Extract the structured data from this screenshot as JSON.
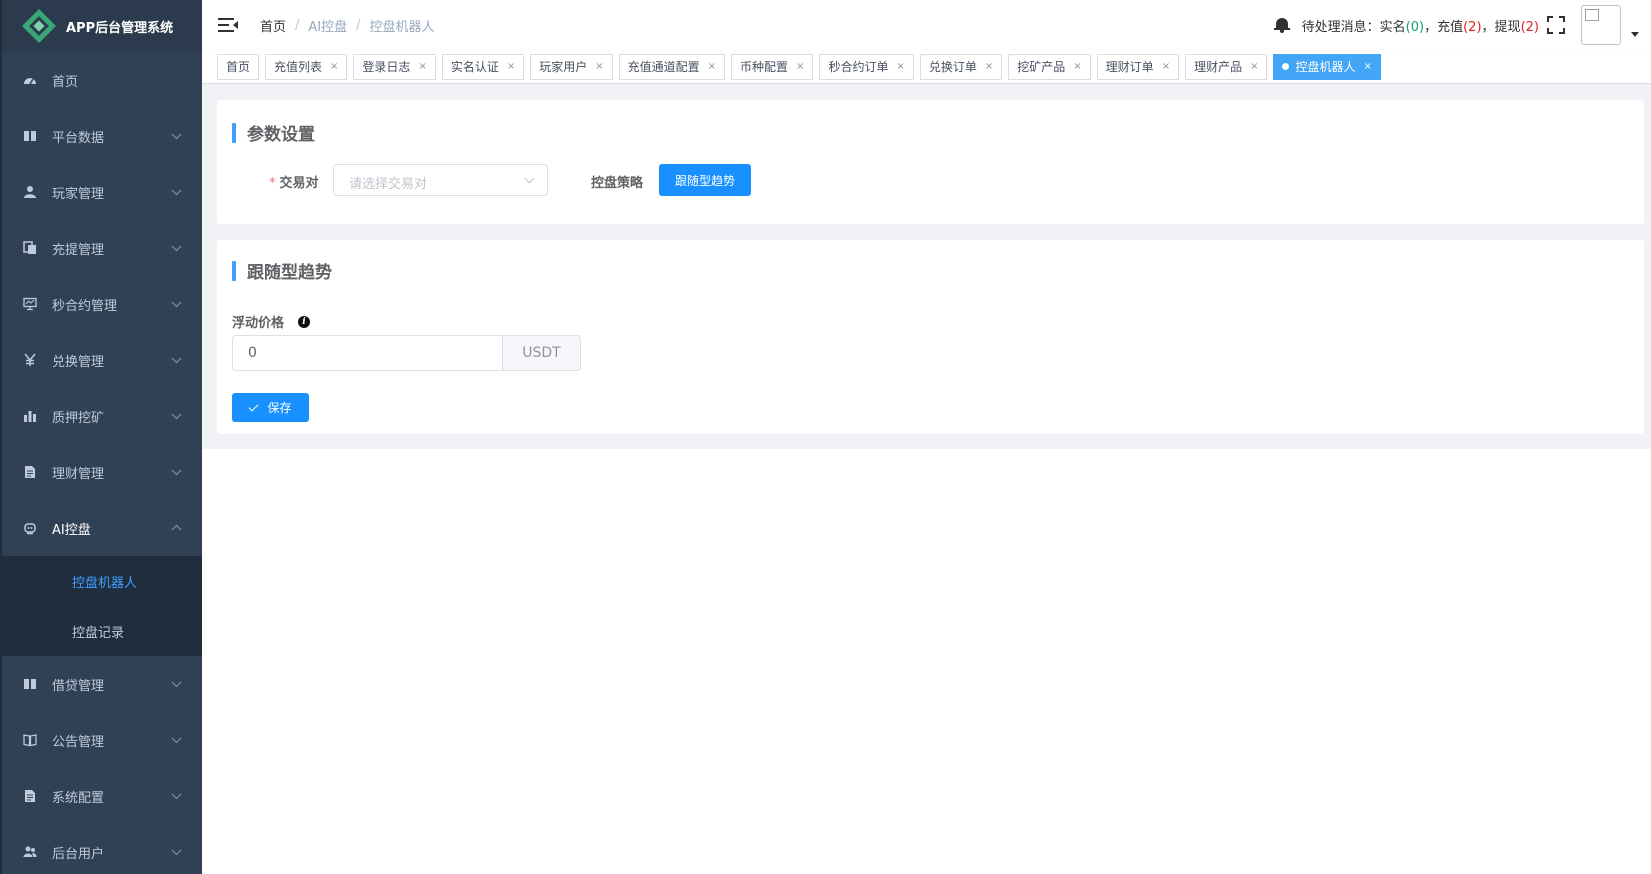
{
  "app": {
    "title": "APP后台管理系统"
  },
  "sidebar": {
    "items": [
      {
        "label": "首页",
        "icon": "dashboard-icon"
      },
      {
        "label": "平台数据",
        "icon": "book-icon"
      },
      {
        "label": "玩家管理",
        "icon": "user-icon"
      },
      {
        "label": "充提管理",
        "icon": "copy-icon"
      },
      {
        "label": "秒合约管理",
        "icon": "monitor-icon"
      },
      {
        "label": "兑换管理",
        "icon": "yen-icon"
      },
      {
        "label": "质押挖矿",
        "icon": "bar-chart-icon"
      },
      {
        "label": "理财管理",
        "icon": "file-text-icon"
      },
      {
        "label": "AI控盘",
        "icon": "robot-icon"
      },
      {
        "label": "借贷管理",
        "icon": "book-icon"
      },
      {
        "label": "公告管理",
        "icon": "open-book-icon"
      },
      {
        "label": "系统配置",
        "icon": "file-text-icon"
      },
      {
        "label": "后台用户",
        "icon": "users-icon"
      }
    ],
    "ai_submenu": [
      "控盘机器人",
      "控盘记录"
    ]
  },
  "breadcrumb": [
    "首页",
    "AI控盘",
    "控盘机器人"
  ],
  "header": {
    "notice_label": "待处理消息：",
    "realname_label": "实名",
    "realname_count": "0",
    "recharge_label": "充值",
    "recharge_count": "2",
    "withdraw_label": "提现",
    "withdraw_count": "2",
    "sep": "，"
  },
  "tags": [
    "首页",
    "充值列表",
    "登录日志",
    "实名认证",
    "玩家用户",
    "充值通道配置",
    "币种配置",
    "秒合约订单",
    "兑换订单",
    "挖矿产品",
    "理财订单",
    "理财产品",
    "控盘机器人"
  ],
  "params": {
    "title": "参数设置",
    "pair_label": "交易对",
    "pair_placeholder": "请选择交易对",
    "strategy_label": "控盘策略",
    "strategy_value": "跟随型趋势"
  },
  "trend": {
    "title": "跟随型趋势",
    "float_label": "浮动价格",
    "float_value": "0",
    "unit": "USDT",
    "save_label": "保存"
  },
  "colors": {
    "primary": "#1890ff",
    "sidebar_bg": "#304156",
    "submenu_bg": "#1f2d3d",
    "active_tag": "#42a5f5"
  }
}
